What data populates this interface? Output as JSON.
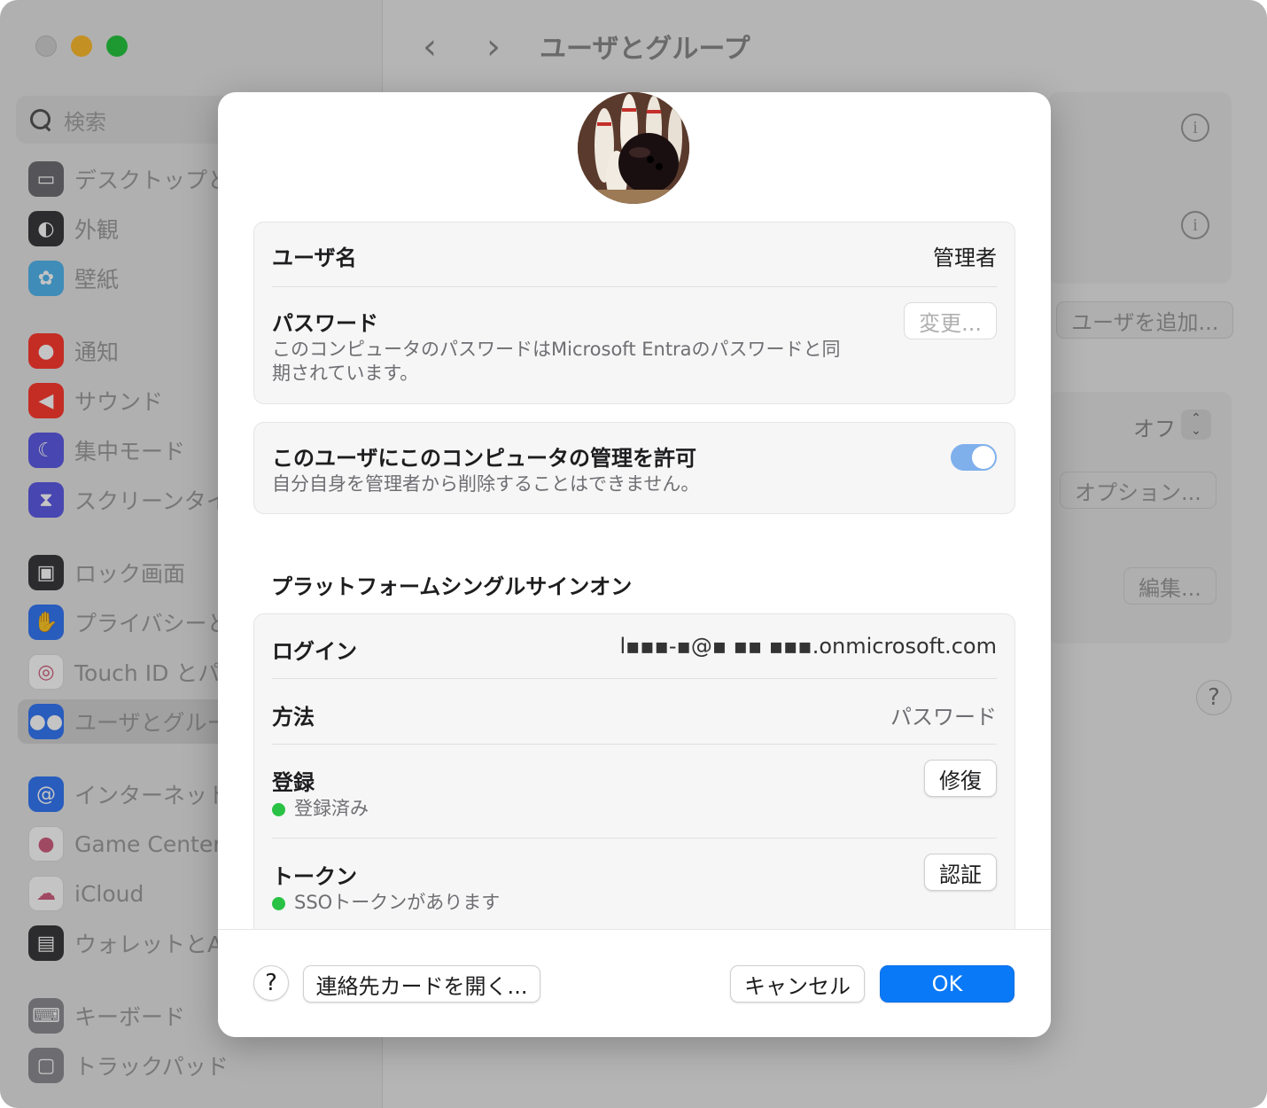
{
  "window": {
    "title": "ユーザとグループ"
  },
  "sidebar": {
    "search_placeholder": "検索",
    "items": [
      {
        "label": "デスクトップと",
        "icon": "desktop-icon",
        "color": "#6f6f74"
      },
      {
        "label": "外観",
        "icon": "appearance-icon",
        "color": "#3a3a3c"
      },
      {
        "label": "壁紙",
        "icon": "wallpaper-icon",
        "color": "#53b6f0"
      },
      {
        "label": "通知",
        "icon": "notification-icon",
        "color": "#ff3b30"
      },
      {
        "label": "サウンド",
        "icon": "sound-icon",
        "color": "#ff3b30"
      },
      {
        "label": "集中モード",
        "icon": "moon-icon",
        "color": "#5e5ce6"
      },
      {
        "label": "スクリーンタイ",
        "icon": "hourglass-icon",
        "color": "#5e5ce6"
      },
      {
        "label": "ロック画面",
        "icon": "lock-icon",
        "color": "#3a3a3c"
      },
      {
        "label": "プライバシーと",
        "icon": "hand-icon",
        "color": "#3478f6"
      },
      {
        "label": "Touch ID とパ",
        "icon": "fingerprint-icon",
        "color": "#ffffff"
      },
      {
        "label": "ユーザとグルー",
        "icon": "users-icon",
        "color": "#3478f6"
      },
      {
        "label": "インターネット",
        "icon": "at-icon",
        "color": "#3478f6"
      },
      {
        "label": "Game Center",
        "icon": "game-center-icon",
        "color": "#ffffff"
      },
      {
        "label": "iCloud",
        "icon": "cloud-icon",
        "color": "#ffffff"
      },
      {
        "label": "ウォレットとA",
        "icon": "wallet-icon",
        "color": "#3a3a3c"
      },
      {
        "label": "キーボード",
        "icon": "keyboard-icon",
        "color": "#8e8e93"
      },
      {
        "label": "トラックパッド",
        "icon": "trackpad-icon",
        "color": "#8e8e93"
      }
    ]
  },
  "main": {
    "add_user_button": "ユーザを追加...",
    "popup_value": "オフ",
    "options_button": "オプション...",
    "edit_button": "編集..."
  },
  "sheet": {
    "username_label": "ユーザ名",
    "username_value": "管理者",
    "password_label": "パスワード",
    "password_button": "変更...",
    "password_note": "このコンピュータのパスワードはMicrosoft Entraのパスワードと同期されています。",
    "admin_label": "このユーザにこのコンピュータの管理を許可",
    "admin_note": "自分自身を管理者から削除することはできません。",
    "admin_toggle_on": true,
    "psso_title": "プラットフォームシングルサインオン",
    "login_label": "ログイン",
    "login_value": "l▪▪▪-▪@▪ ▪▪ ▪▪▪.onmicrosoft.com",
    "method_label": "方法",
    "method_value": "パスワード",
    "registration_label": "登録",
    "registration_status": "登録済み",
    "repair_button": "修復",
    "token_label": "トークン",
    "token_status": "SSOトークンがあります",
    "authenticate_button": "認証",
    "status_color": "#29c244",
    "help_button": "?",
    "open_contact_button": "連絡先カードを開く...",
    "cancel_button": "キャンセル",
    "ok_button": "OK",
    "accent_color": "#0a79f7"
  }
}
